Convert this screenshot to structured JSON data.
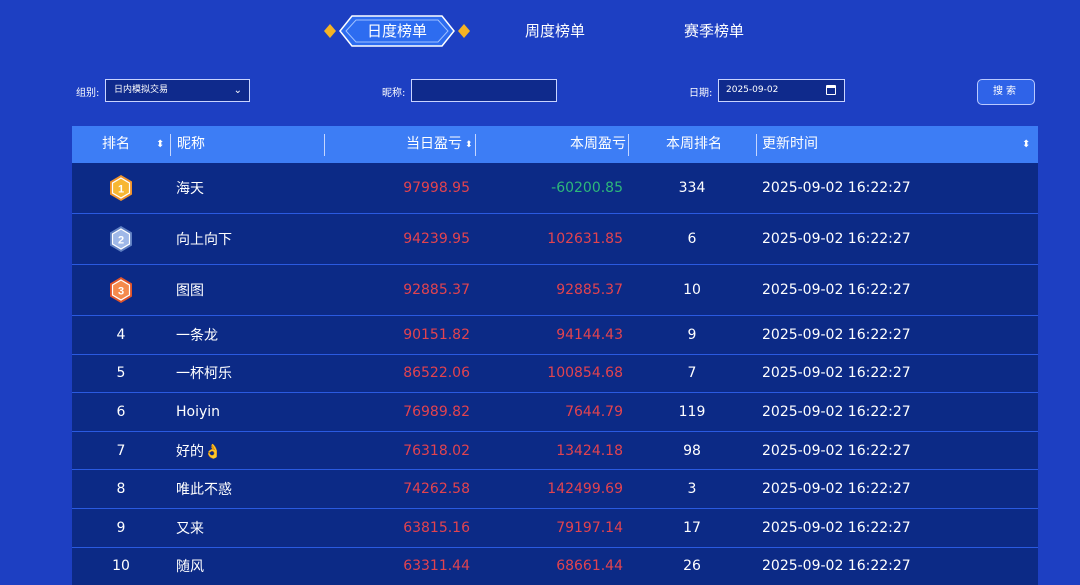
{
  "tabs": {
    "daily": "日度榜单",
    "weekly": "周度榜单",
    "season": "赛季榜单"
  },
  "filters": {
    "group_label": "组别:",
    "group_value": "日内模拟交易",
    "nickname_label": "昵称:",
    "nickname_value": "",
    "date_label": "日期:",
    "date_value": "2025-09-02",
    "search_label": "搜索"
  },
  "table": {
    "headers": {
      "rank": "排名",
      "nickname": "昵称",
      "daily_pnl": "当日盈亏",
      "weekly_pnl": "本周盈亏",
      "weekly_rank": "本周排名",
      "updated": "更新时间"
    },
    "rows": [
      {
        "rank": "1",
        "medal": "gold",
        "name": "海天",
        "daily": "97998.95",
        "weekly": "-60200.85",
        "wrank": "334",
        "time": "2025-09-02 16:22:27"
      },
      {
        "rank": "2",
        "medal": "silver",
        "name": "向上向下",
        "daily": "94239.95",
        "weekly": "102631.85",
        "wrank": "6",
        "time": "2025-09-02 16:22:27"
      },
      {
        "rank": "3",
        "medal": "bronze",
        "name": "图图",
        "daily": "92885.37",
        "weekly": "92885.37",
        "wrank": "10",
        "time": "2025-09-02 16:22:27"
      },
      {
        "rank": "4",
        "name": "一条龙",
        "daily": "90151.82",
        "weekly": "94144.43",
        "wrank": "9",
        "time": "2025-09-02 16:22:27"
      },
      {
        "rank": "5",
        "name": "一杯柯乐",
        "daily": "86522.06",
        "weekly": "100854.68",
        "wrank": "7",
        "time": "2025-09-02 16:22:27"
      },
      {
        "rank": "6",
        "name": "Hoiyin",
        "daily": "76989.82",
        "weekly": "7644.79",
        "wrank": "119",
        "time": "2025-09-02 16:22:27"
      },
      {
        "rank": "7",
        "name": "好的👌",
        "daily": "76318.02",
        "weekly": "13424.18",
        "wrank": "98",
        "time": "2025-09-02 16:22:27"
      },
      {
        "rank": "8",
        "name": "唯此不惑",
        "daily": "74262.58",
        "weekly": "142499.69",
        "wrank": "3",
        "time": "2025-09-02 16:22:27"
      },
      {
        "rank": "9",
        "name": "又来",
        "daily": "63815.16",
        "weekly": "79197.14",
        "wrank": "17",
        "time": "2025-09-02 16:22:27"
      },
      {
        "rank": "10",
        "name": "随风",
        "daily": "63311.44",
        "weekly": "68661.44",
        "wrank": "26",
        "time": "2025-09-02 16:22:27"
      }
    ]
  },
  "colors": {
    "background": "#1d3fc2",
    "header": "#3d7df5",
    "row": "#0c2a86",
    "positive": "#e2434f",
    "negative": "#2db87a",
    "gold": "#f5a623",
    "silver": "#7f9ed8",
    "bronze": "#ef6a2e"
  },
  "icons": {
    "select": "chevron-down-icon",
    "date": "calendar-icon",
    "sort": "sort-icon",
    "medals": [
      "gold-medal-icon",
      "silver-medal-icon",
      "bronze-medal-icon"
    ]
  }
}
